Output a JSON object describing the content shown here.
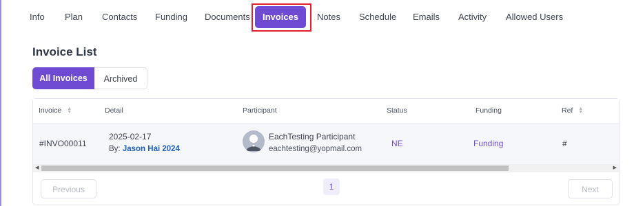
{
  "tabs": [
    {
      "label": "Info"
    },
    {
      "label": "Plan"
    },
    {
      "label": "Contacts"
    },
    {
      "label": "Funding"
    },
    {
      "label": "Documents"
    },
    {
      "label": "Invoices"
    },
    {
      "label": "Notes"
    },
    {
      "label": "Schedule"
    },
    {
      "label": "Emails"
    },
    {
      "label": "Activity"
    },
    {
      "label": "Allowed Users"
    }
  ],
  "page_title": "Invoice List",
  "filters": {
    "all": "All Invoices",
    "archived": "Archived"
  },
  "table": {
    "columns": {
      "invoice": "Invoice",
      "detail": "Detail",
      "participant": "Participant",
      "status": "Status",
      "funding": "Funding",
      "ref": "Ref"
    },
    "rows": [
      {
        "invoice": "#INVO00011",
        "date": "2025-02-17",
        "by_label": "By:",
        "by_name": "Jason Hai 2024",
        "participant_name": "EachTesting Participant",
        "participant_email": "eachtesting@yopmail.com",
        "status": "NE",
        "funding": "Funding",
        "ref": "#"
      }
    ]
  },
  "pagination": {
    "previous": "Previous",
    "current_page": "1",
    "next": "Next"
  },
  "colors": {
    "accent": "#6f4bd3",
    "highlight_outline": "#e0202c",
    "link": "#1e5fbf"
  }
}
